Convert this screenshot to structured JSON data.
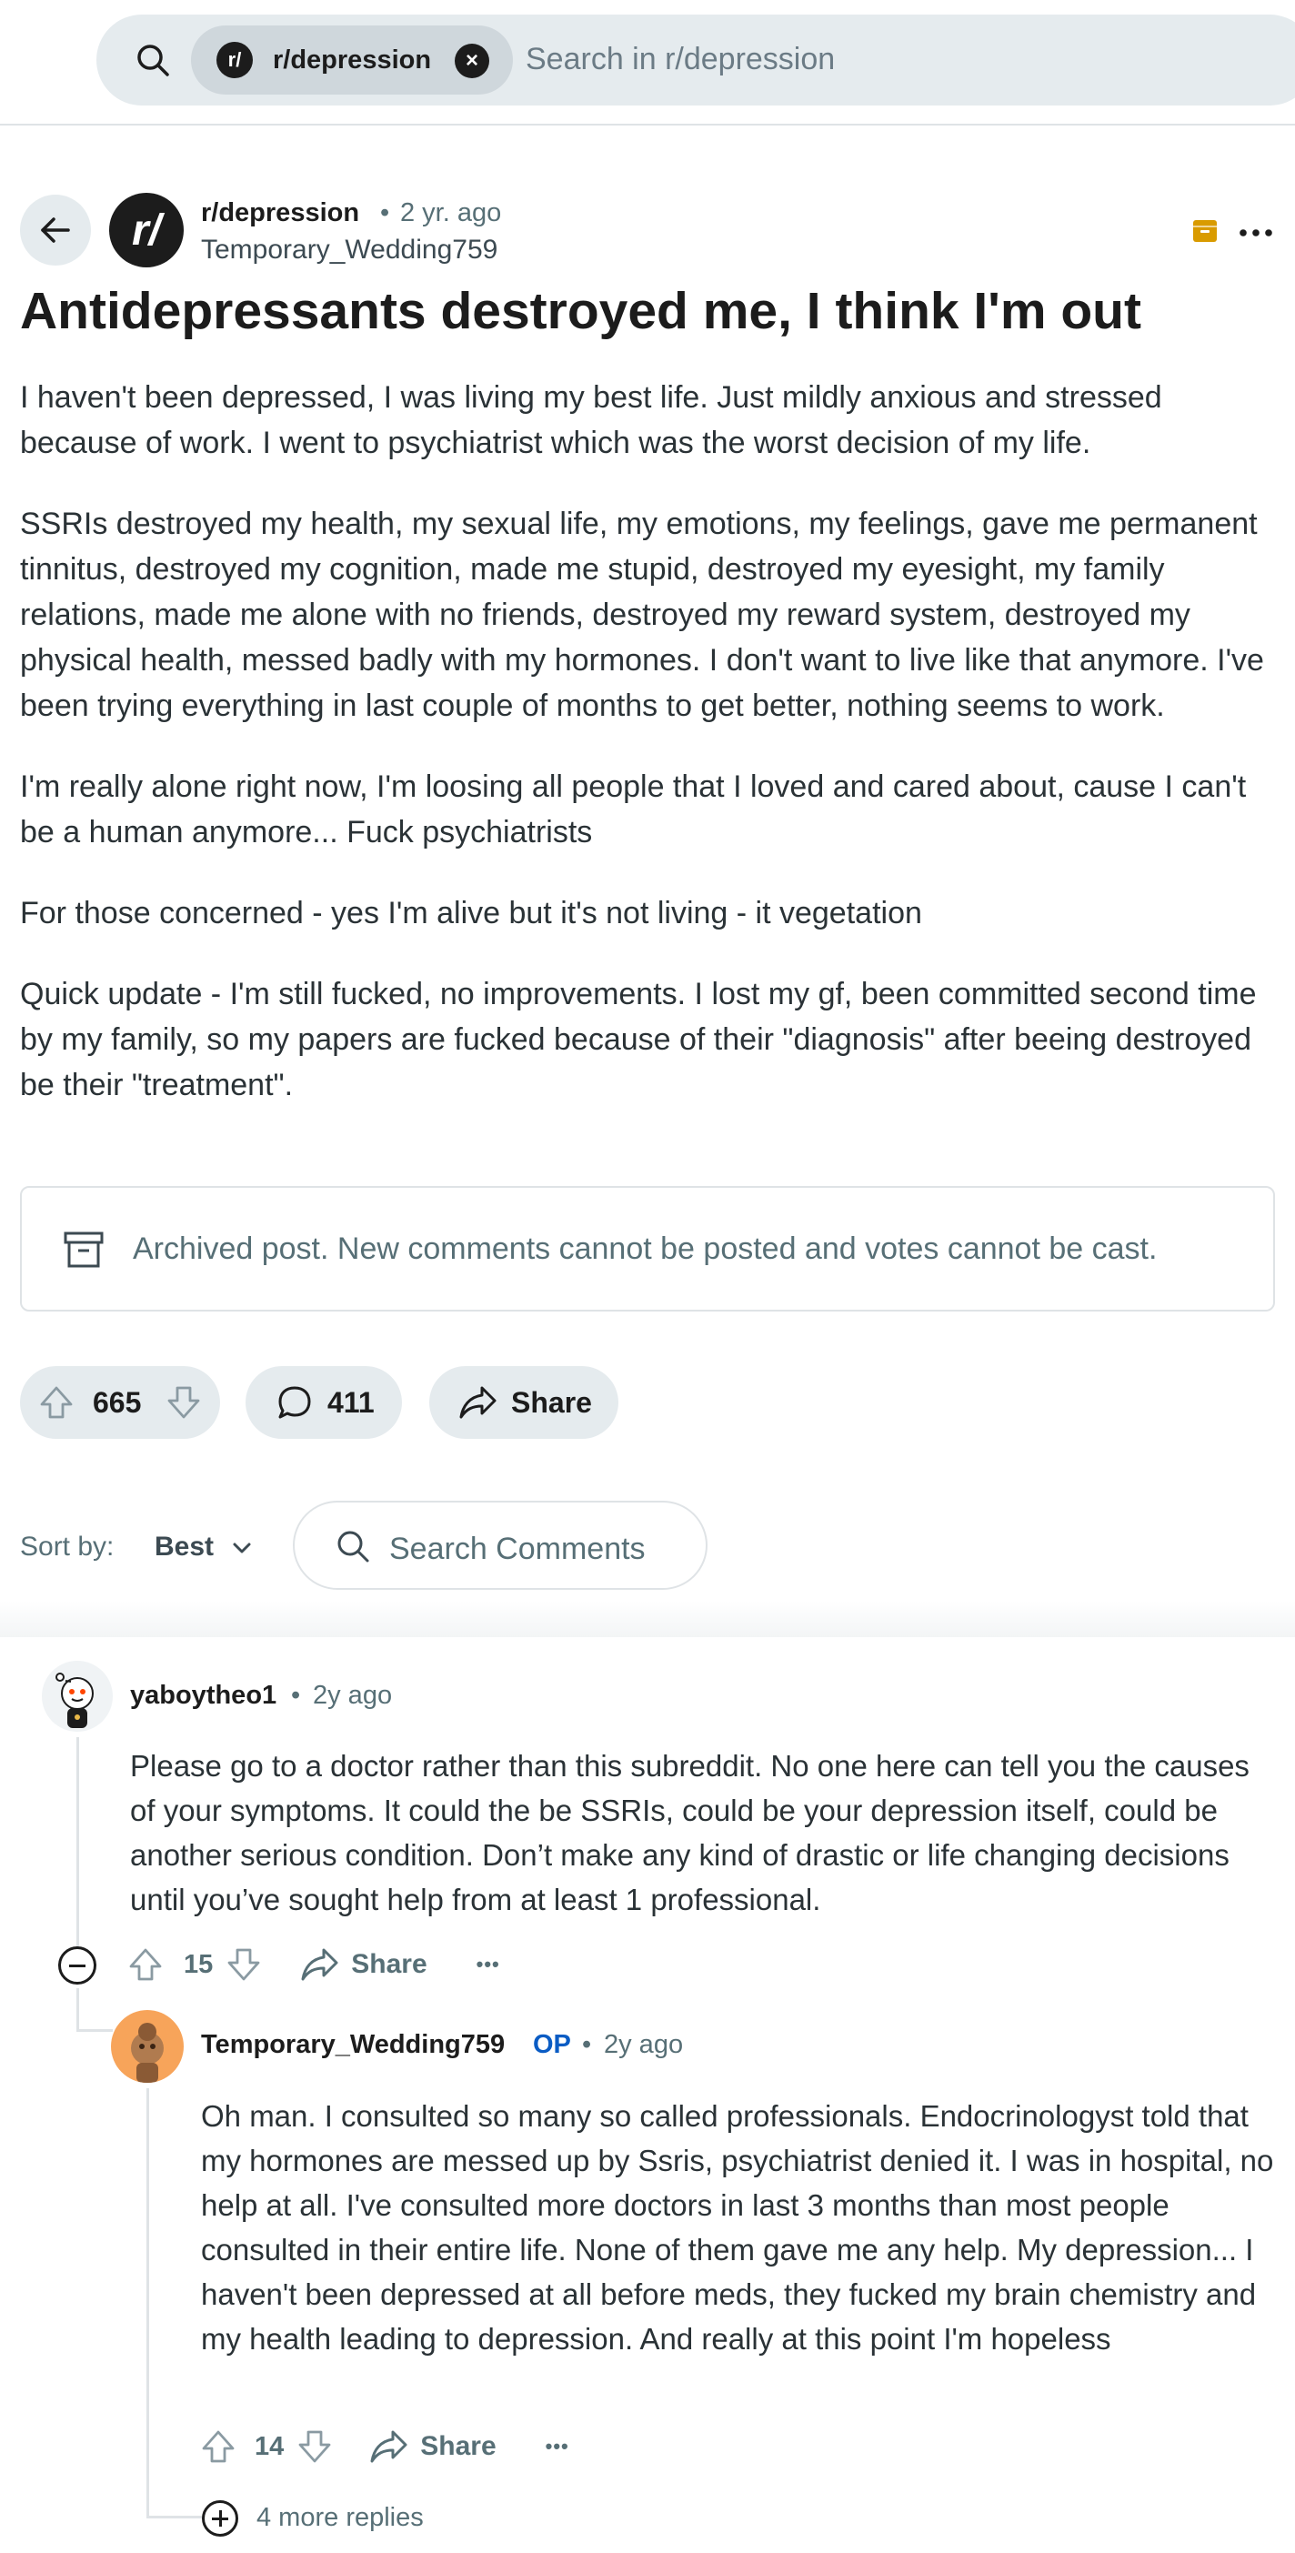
{
  "search": {
    "chip_label": "r/depression",
    "chip_avatar": "r/",
    "placeholder": "Search in r/depression"
  },
  "post": {
    "subreddit": "r/depression",
    "subreddit_avatar": "r/",
    "dot": "•",
    "age": "2 yr. ago",
    "author": "Temporary_Wedding759",
    "title": "Antidepressants destroyed me, I think I'm out",
    "paragraphs": [
      "I haven't been depressed, I was living my best life. Just mildly anxious and stressed because of work. I went to psychiatrist which was the worst decision of my life.",
      "SSRIs destroyed my health, my sexual life, my emotions, my feelings, gave me permanent tinnitus, destroyed my cognition, made me stupid, destroyed my eyesight, my family relations, made me alone with no friends, destroyed my reward system, destroyed my physical health, messed badly with my hormones. I don't want to live like that anymore. I've been trying everything in last couple of months to get better, nothing seems to work.",
      "I'm really alone right now, I'm loosing all people that I loved and cared about, cause I can't be a human anymore... Fuck psychiatrists",
      "For those concerned - yes I'm alive but it's not living - it vegetation",
      "Quick update - I'm still fucked, no improvements. I lost my gf, been committed second time by my family, so my papers are fucked because of their \"diagnosis\" after beeing destroyed be their \"treatment\"."
    ],
    "archived_notice": "Archived post. New comments cannot be posted and votes cannot be cast.",
    "votes": "665",
    "comments": "411",
    "share_label": "Share"
  },
  "sort": {
    "label": "Sort by:",
    "value": "Best",
    "search_placeholder": "Search Comments"
  },
  "comments": [
    {
      "user": "yaboytheo1",
      "dot": "•",
      "age": "2y ago",
      "text": "Please go to a doctor rather than this subreddit. No one here can tell you the causes of your symptoms. It could the be SSRIs, could be your depression itself, could be another serious condition. Don’t make any kind of drastic or life changing decisions until you’ve sought help from at least 1 professional.",
      "votes": "15",
      "share_label": "Share",
      "more": "•••"
    },
    {
      "user": "Temporary_Wedding759",
      "badge": "OP",
      "dot": "•",
      "age": "2y ago",
      "text": "Oh man. I consulted so many so called professionals. Endocrinologyst told that my hormones are messed up by Ssris, psychiatrist denied it. I was in hospital, no help at all. I've consulted more doctors in last 3 months than most people consulted in their entire life. None of them gave me any help. My depression... I haven't been depressed at all before meds, they fucked my brain chemistry and my health leading to depression. And really at this point I'm hopeless",
      "votes": "14",
      "share_label": "Share",
      "more": "•••"
    }
  ],
  "more_replies": "4 more replies",
  "colors": {
    "accent_op": "#0a5cc4",
    "archive_icon": "#d99b00",
    "pill_bg": "#e5ebee"
  }
}
